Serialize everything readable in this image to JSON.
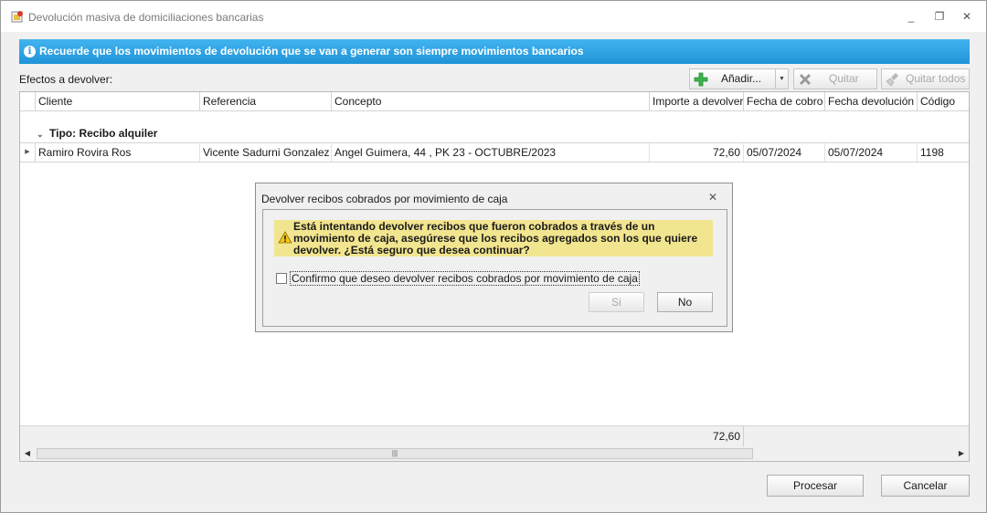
{
  "window": {
    "title": "Devolución masiva de domiciliaciones bancarias",
    "minimize_glyph": "_",
    "restore_glyph": "❐",
    "close_glyph": "✕"
  },
  "banner": {
    "icon": "info-icon",
    "icon_glyph": "i",
    "text": "Recuerde que los movimientos de devolución que se van a generar son siempre movimientos bancarios"
  },
  "effects_label": "Efectos a devolver:",
  "toolbar": {
    "add_label": "Añadir...",
    "remove_label": "Quitar",
    "remove_all_label": "Quitar todos"
  },
  "grid": {
    "columns": [
      "Cliente",
      "Referencia",
      "Concepto",
      "Importe a devolver",
      "Fecha de cobro",
      "Fecha devolución",
      "Código"
    ],
    "group_label": "Tipo: Recibo alquiler",
    "rows": [
      {
        "cliente": "Ramiro Rovira Ros",
        "referencia": "Vicente Sadurni Gonzalez",
        "concepto": "Angel Guimera, 44 , PK 23 - OCTUBRE/2023",
        "importe": "72,60",
        "fecha_cobro": "05/07/2024",
        "fecha_devolucion": "05/07/2024",
        "codigo": "1198"
      }
    ],
    "total": "72,60"
  },
  "buttons": {
    "process_label": "Procesar",
    "cancel_label": "Cancelar"
  },
  "dialog": {
    "title": "Devolver recibos cobrados por movimiento de caja",
    "close_glyph": "✕",
    "warning_text": "Está intentando devolver recibos que fueron cobrados a través de un movimiento de caja, asegúrese que los recibos agregados son los que quiere devolver. ¿Está seguro que desea continuar?",
    "checkbox_label": "Confirmo que deseo devolver recibos cobrados por movimiento de caja",
    "checkbox_checked": false,
    "yes_label": "Si",
    "no_label": "No"
  },
  "colors": {
    "banner_top": "#42b4ef",
    "banner_bottom": "#1f93d8",
    "warning_bg": "#f2e58f",
    "add_icon": "#3bb54a"
  }
}
